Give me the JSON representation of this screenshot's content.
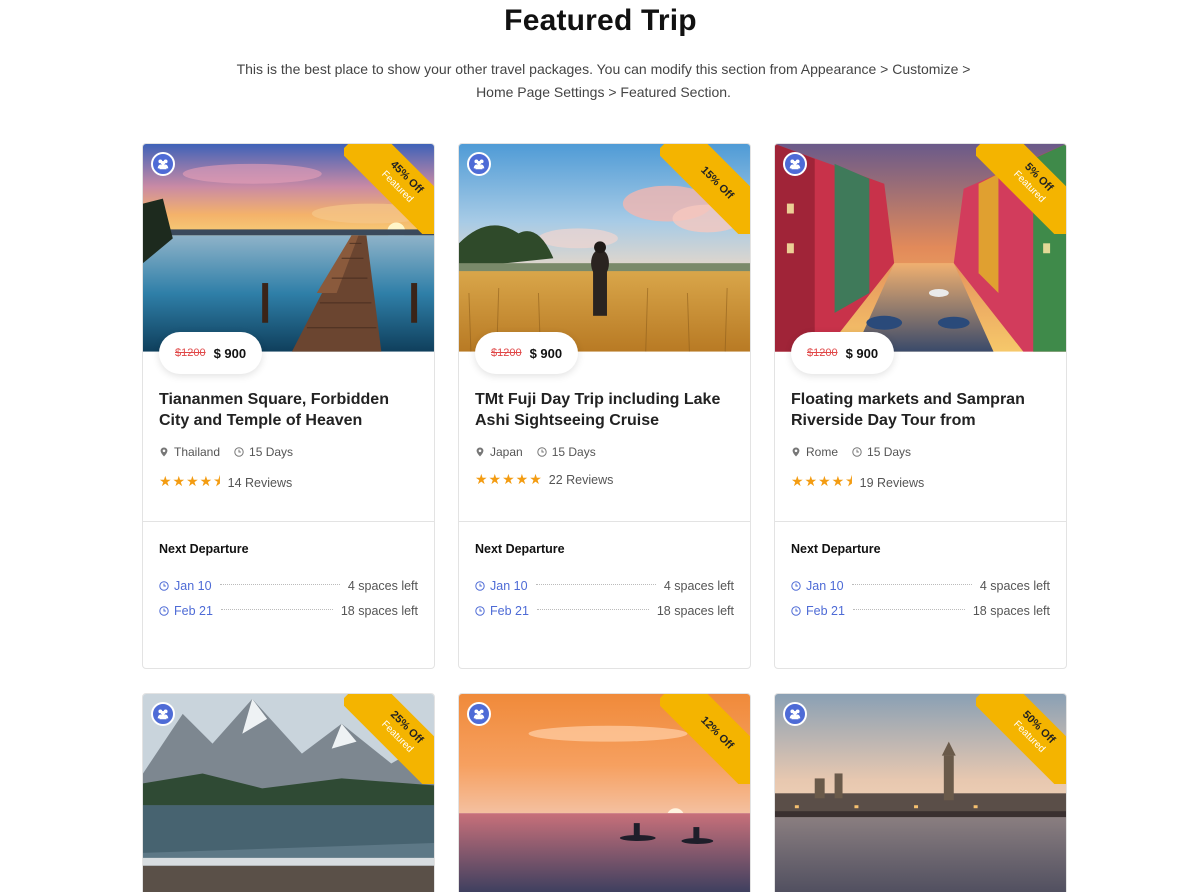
{
  "section": {
    "title": "Featured Trip",
    "description": "This is the best place to show your other travel packages. You can modify this section from Appearance > Customize > Home Page Settings > Featured Section."
  },
  "labels": {
    "next_departure": "Next Departure"
  },
  "colors": {
    "accent": "#4e6bd6",
    "ribbon": "#f4b400",
    "star": "#f39c12",
    "old_price": "#e04848"
  },
  "trips": [
    {
      "discount": "45% Off",
      "featured": "Featured",
      "price_old": "$1200",
      "price_new": "$ 900",
      "title": "Tiananmen Square, Forbidden City and Temple of Heaven",
      "location": "Thailand",
      "duration": "15 Days",
      "rating": 4.5,
      "reviews": "14 Reviews",
      "departures": [
        {
          "date": "Jan 10",
          "spaces": "4 spaces left"
        },
        {
          "date": "Feb 21",
          "spaces": "18 spaces left"
        }
      ],
      "image": "lake-pier-sunset"
    },
    {
      "discount": "15% Off",
      "featured": "",
      "price_old": "$1200",
      "price_new": "$ 900",
      "title": "TMt Fuji Day Trip including Lake Ashi Sightseeing Cruise",
      "location": "Japan",
      "duration": "15 Days",
      "rating": 5,
      "reviews": "22 Reviews",
      "departures": [
        {
          "date": "Jan 10",
          "spaces": "4 spaces left"
        },
        {
          "date": "Feb 21",
          "spaces": "18 spaces left"
        }
      ],
      "image": "wheat-field-hiker"
    },
    {
      "discount": "5% Off",
      "featured": "Featured",
      "price_old": "$1200",
      "price_new": "$ 900",
      "title": "Floating markets and Sampran Riverside Day Tour from",
      "location": "Rome",
      "duration": "15 Days",
      "rating": 4.5,
      "reviews": "19 Reviews",
      "departures": [
        {
          "date": "Jan 10",
          "spaces": "4 spaces left"
        },
        {
          "date": "Feb 21",
          "spaces": "18 spaces left"
        }
      ],
      "image": "canal-colorful-houses"
    },
    {
      "discount": "25% Off",
      "featured": "Featured",
      "image": "mountain-lake"
    },
    {
      "discount": "12% Off",
      "featured": "",
      "image": "sunset-kayak"
    },
    {
      "discount": "50% Off",
      "featured": "Featured",
      "image": "london-river"
    }
  ]
}
